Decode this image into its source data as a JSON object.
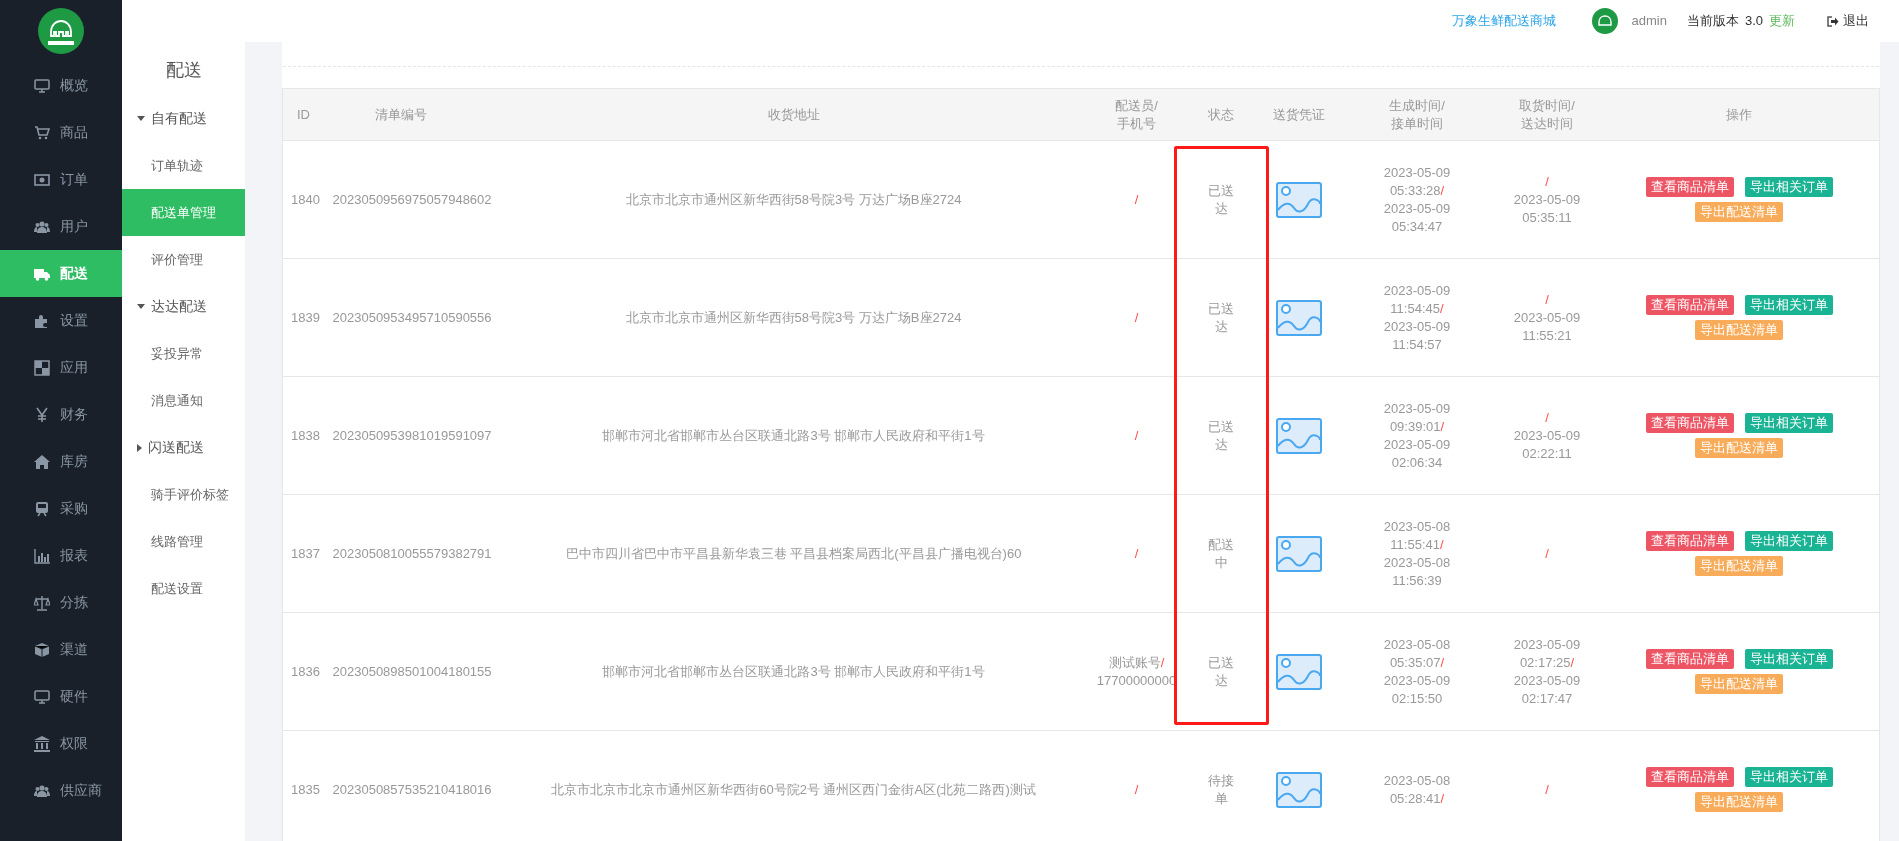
{
  "top_bar": {
    "shop_link": "万象生鲜配送商城",
    "user": "admin",
    "version_label": "当前版本",
    "version": "3.0",
    "update_link": "更新",
    "logout": "退出"
  },
  "main_nav": [
    {
      "label": "概览",
      "selected": false
    },
    {
      "label": "商品",
      "selected": false
    },
    {
      "label": "订单",
      "selected": false
    },
    {
      "label": "用户",
      "selected": false
    },
    {
      "label": "配送",
      "selected": true
    },
    {
      "label": "设置",
      "selected": false
    },
    {
      "label": "应用",
      "selected": false
    },
    {
      "label": "财务",
      "selected": false
    },
    {
      "label": "库房",
      "selected": false
    },
    {
      "label": "采购",
      "selected": false
    },
    {
      "label": "报表",
      "selected": false
    },
    {
      "label": "分拣",
      "selected": false
    },
    {
      "label": "渠道",
      "selected": false
    },
    {
      "label": "硬件",
      "selected": false
    },
    {
      "label": "权限",
      "selected": false
    },
    {
      "label": "供应商",
      "selected": false
    }
  ],
  "sub_nav": {
    "title": "配送",
    "groups": [
      {
        "label": "自有配送",
        "expanded": true,
        "children": [
          {
            "label": "订单轨迹",
            "selected": false
          },
          {
            "label": "配送单管理",
            "selected": true
          },
          {
            "label": "评价管理",
            "selected": false
          }
        ]
      },
      {
        "label": "达达配送",
        "expanded": true,
        "children": [
          {
            "label": "妥投异常",
            "selected": false
          },
          {
            "label": "消息通知",
            "selected": false
          }
        ]
      },
      {
        "label": "闪送配送",
        "expanded": false,
        "children": [
          {
            "label": "骑手评价标签",
            "selected": false
          },
          {
            "label": "线路管理",
            "selected": false
          },
          {
            "label": "配送设置",
            "selected": false
          }
        ]
      }
    ]
  },
  "table": {
    "columns": [
      "ID",
      "清单编号",
      "收货地址",
      "配送员/\n手机号",
      "状态",
      "送货凭证",
      "生成时间/\n接单时间",
      "取货时间/\n送达时间",
      "操作"
    ],
    "rows": [
      {
        "id": "1840",
        "number": "2023050956975057948602",
        "address": "北京市北京市通州区新华西街58号院3号 万达广场B座2724",
        "courier": {
          "separator": "/"
        },
        "status": "已送达",
        "highlighted": true,
        "created": {
          "first": "2023-05-09 05:33:28",
          "separator": "/",
          "second": "2023-05-09 05:34:47"
        },
        "pickup": {
          "separator": "/",
          "second": "2023-05-09 05:35:11"
        },
        "actions": [
          {
            "label": "查看商品清单",
            "kind": "danger"
          },
          {
            "label": "导出相关订单",
            "kind": "primary"
          },
          {
            "label": "导出配送清单",
            "kind": "warning"
          }
        ]
      },
      {
        "id": "1839",
        "number": "2023050953495710590556",
        "address": "北京市北京市通州区新华西街58号院3号 万达广场B座2724",
        "courier": {
          "separator": "/"
        },
        "status": "已送达",
        "highlighted": true,
        "created": {
          "first": "2023-05-09 11:54:45",
          "separator": "/",
          "second": "2023-05-09 11:54:57"
        },
        "pickup": {
          "separator": "/",
          "second": "2023-05-09 11:55:21"
        },
        "actions": [
          {
            "label": "查看商品清单",
            "kind": "danger"
          },
          {
            "label": "导出相关订单",
            "kind": "primary"
          },
          {
            "label": "导出配送清单",
            "kind": "warning"
          }
        ]
      },
      {
        "id": "1838",
        "number": "2023050953981019591097",
        "address": "邯郸市河北省邯郸市丛台区联通北路3号 邯郸市人民政府和平街1号",
        "courier": {
          "separator": "/"
        },
        "status": "已送达",
        "highlighted": true,
        "created": {
          "first": "2023-05-09 09:39:01",
          "separator": "/",
          "second": "2023-05-09 02:06:34"
        },
        "pickup": {
          "separator": "/",
          "second": "2023-05-09 02:22:11"
        },
        "actions": [
          {
            "label": "查看商品清单",
            "kind": "danger"
          },
          {
            "label": "导出相关订单",
            "kind": "primary"
          },
          {
            "label": "导出配送清单",
            "kind": "warning"
          }
        ]
      },
      {
        "id": "1837",
        "number": "2023050810055579382791",
        "address": "巴中市四川省巴中市平昌县新华袁三巷 平昌县档案局西北(平昌县广播电视台)60",
        "courier": {
          "separator": "/"
        },
        "status": "配送中",
        "highlighted": true,
        "created": {
          "first": "2023-05-08 11:55:41",
          "separator": "/",
          "second": "2023-05-08 11:56:39"
        },
        "pickup": {
          "separator": "/"
        },
        "actions": [
          {
            "label": "查看商品清单",
            "kind": "danger"
          },
          {
            "label": "导出相关订单",
            "kind": "primary"
          },
          {
            "label": "导出配送清单",
            "kind": "warning"
          }
        ]
      },
      {
        "id": "1836",
        "number": "2023050898501004180155",
        "address": "邯郸市河北省邯郸市丛台区联通北路3号 邯郸市人民政府和平街1号",
        "courier": {
          "name": "测试账号",
          "separator": "/",
          "phone": "17700000000"
        },
        "status": "已送达",
        "highlighted": true,
        "created": {
          "first": "2023-05-08 05:35:07",
          "separator": "/",
          "second": "2023-05-09 02:15:50"
        },
        "pickup": {
          "first": "2023-05-09 02:17:25",
          "separator": "/",
          "second": "2023-05-09 02:17:47"
        },
        "actions": [
          {
            "label": "查看商品清单",
            "kind": "danger"
          },
          {
            "label": "导出相关订单",
            "kind": "primary"
          },
          {
            "label": "导出配送清单",
            "kind": "warning"
          }
        ]
      },
      {
        "id": "1835",
        "number": "2023050857535210418016",
        "address": "北京市北京市北京市通州区新华西街60号院2号 通州区西门金街A区(北苑二路西)测试",
        "courier": {
          "separator": "/"
        },
        "status": "待接单",
        "highlighted": false,
        "created": {
          "first": "2023-05-08 05:28:41",
          "separator": "/"
        },
        "pickup": {
          "separator": "/"
        },
        "actions": [
          {
            "label": "查看商品清单",
            "kind": "danger"
          },
          {
            "label": "导出相关订单",
            "kind": "primary"
          },
          {
            "label": "导出配送清单",
            "kind": "warning"
          }
        ]
      }
    ]
  }
}
